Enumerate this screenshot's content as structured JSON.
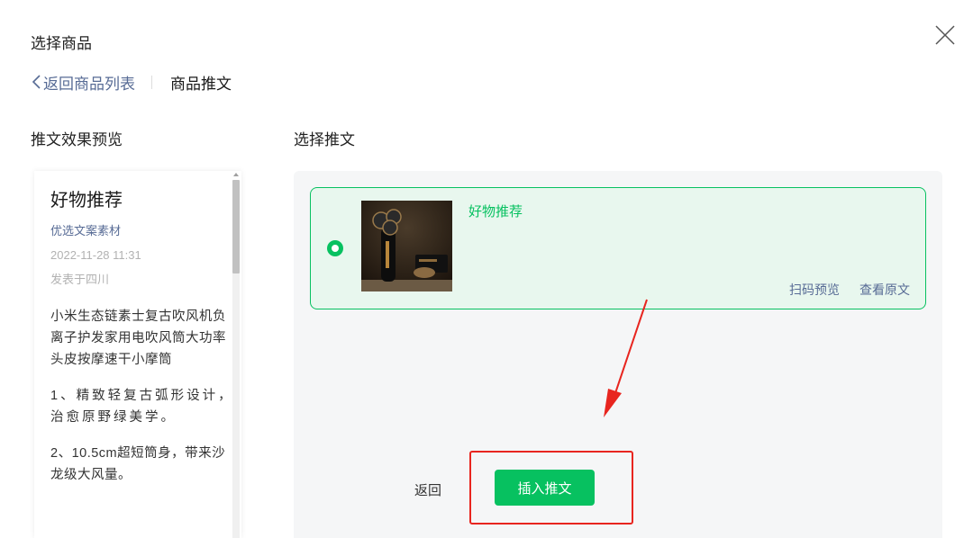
{
  "dialog": {
    "title": "选择商品"
  },
  "breadcrumb": {
    "back_label": "返回商品列表",
    "current_label": "商品推文"
  },
  "sections": {
    "preview_label": "推文效果预览",
    "select_label": "选择推文"
  },
  "preview": {
    "title": "好物推荐",
    "author": "优选文案素材",
    "date": "2022-11-28 11:31",
    "location": "发表于四川",
    "paragraphs": [
      "小米生态链素士复古吹风机负离子护发家用电吹风筒大功率头皮按摩速干小摩筒",
      "1、精致轻复古弧形设计，治愈原野绿美学。",
      "2、10.5cm超短筒身，带来沙龙级大风量。"
    ]
  },
  "article_card": {
    "title": "好物推荐",
    "scan_preview_label": "扫码预览",
    "view_original_label": "查看原文",
    "selected": true
  },
  "actions": {
    "back_label": "返回",
    "insert_label": "插入推文"
  },
  "colors": {
    "accent": "#07c160",
    "link": "#576b95",
    "annotation": "#e8251f",
    "card_bg": "#e8f7ee"
  },
  "icons": {
    "close": "close-icon",
    "back": "chevron-left-icon",
    "radio": "radio-selected-icon"
  }
}
